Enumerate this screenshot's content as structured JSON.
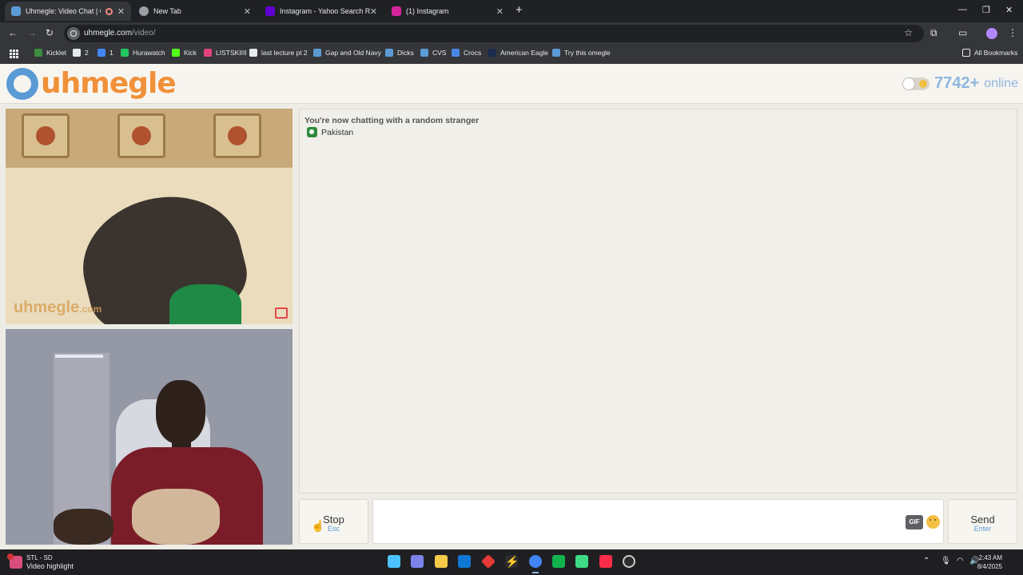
{
  "browser": {
    "tabs": [
      {
        "title": "Uhmegle: Video Chat | Ome",
        "active": true,
        "recording": true
      },
      {
        "title": "New Tab",
        "active": false
      },
      {
        "title": "Instagram - Yahoo Search Resul",
        "active": false
      },
      {
        "title": "(1) Instagram",
        "active": false
      }
    ],
    "new_tab": "+",
    "window_controls": {
      "minimize": "—",
      "restore": "❐",
      "close": "✕"
    },
    "url_domain": "uhmegle.com",
    "url_path": "/video/",
    "bookmarks": [
      {
        "label": "Kicklet",
        "color": "#3c8d40"
      },
      {
        "label": "2",
        "color": "#e8eaed"
      },
      {
        "label": "1",
        "color": "#4285f4"
      },
      {
        "label": "Hurawatch",
        "color": "#22c55e"
      },
      {
        "label": "Kick",
        "color": "#53fc18"
      },
      {
        "label": "LISTSKIIII",
        "color": "#e0447a"
      },
      {
        "label": "last lecture pt 2",
        "color": "#e8eaed"
      },
      {
        "label": "Gap and Old Navy",
        "color": "#5b9bd5"
      },
      {
        "label": "Dicks",
        "color": "#5b9bd5"
      },
      {
        "label": "CVS",
        "color": "#5b9bd5"
      },
      {
        "label": "Crocs",
        "color": "#4a86e8"
      },
      {
        "label": "American Eagle",
        "color": "#1a2b4c"
      },
      {
        "label": "Try this omegle",
        "color": "#5b9bd5"
      }
    ],
    "all_bookmarks": "All Bookmarks"
  },
  "site": {
    "logo_text": "uhmegle",
    "online_count": "7742+",
    "online_label": "online",
    "watermark_main": "uhmegle",
    "watermark_suffix": ".com"
  },
  "chat": {
    "status": "You're now chatting with a random stranger",
    "country": "Pakistan"
  },
  "controls": {
    "stop_label": "Stop",
    "stop_key": "Esc",
    "gif_label": "GIF",
    "send_label": "Send",
    "send_key": "Enter"
  },
  "taskbar": {
    "news_title": "STL - SD",
    "news_subtitle": "Video highlight",
    "news_badge": "4",
    "time": "2:43 AM",
    "date": "8/4/2025"
  },
  "colors": {
    "accent_orange": "#f0913a",
    "accent_blue": "#5b9bd5",
    "browser_dark": "#202124"
  }
}
